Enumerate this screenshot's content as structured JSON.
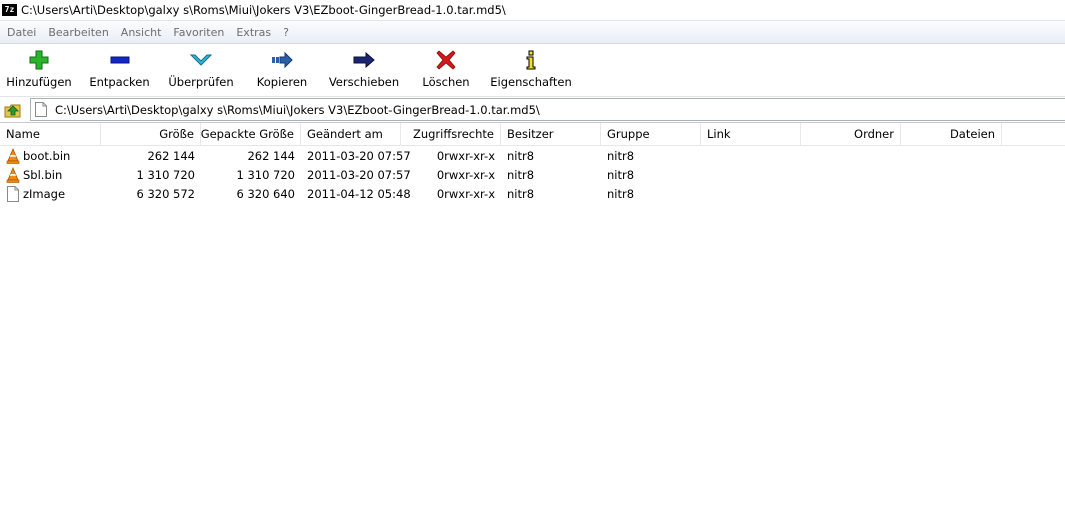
{
  "window": {
    "title": "C:\\Users\\Arti\\Desktop\\galxy s\\Roms\\Miui\\Jokers V3\\EZboot-GingerBread-1.0.tar.md5\\",
    "app_icon_text": "7z"
  },
  "menu": [
    {
      "label": "Datei"
    },
    {
      "label": "Bearbeiten"
    },
    {
      "label": "Ansicht"
    },
    {
      "label": "Favoriten"
    },
    {
      "label": "Extras"
    },
    {
      "label": "?"
    }
  ],
  "toolbar": [
    {
      "label": "Hinzufügen",
      "icon": "add-icon"
    },
    {
      "label": "Entpacken",
      "icon": "extract-icon"
    },
    {
      "label": "Überprüfen",
      "icon": "test-icon"
    },
    {
      "label": "Kopieren",
      "icon": "copy-icon"
    },
    {
      "label": "Verschieben",
      "icon": "move-icon"
    },
    {
      "label": "Löschen",
      "icon": "delete-icon"
    },
    {
      "label": "Eigenschaften",
      "icon": "info-icon"
    }
  ],
  "address": {
    "path": "C:\\Users\\Arti\\Desktop\\galxy s\\Roms\\Miui\\Jokers V3\\EZboot-GingerBread-1.0.tar.md5\\"
  },
  "columns": {
    "name": "Name",
    "size": "Größe",
    "packed": "Gepackte Größe",
    "modified": "Geändert am",
    "access": "Zugriffsrechte",
    "owner": "Besitzer",
    "group": "Gruppe",
    "link": "Link",
    "folders": "Ordner",
    "files": "Dateien"
  },
  "files": [
    {
      "name": "boot.bin",
      "size": "262 144",
      "packed": "262 144",
      "modified": "2011-03-20 07:57",
      "access": "0rwxr-xr-x",
      "owner": "nitr8",
      "group": "nitr8",
      "icon": "vlc-cone-icon"
    },
    {
      "name": "Sbl.bin",
      "size": "1 310 720",
      "packed": "1 310 720",
      "modified": "2011-03-20 07:57",
      "access": "0rwxr-xr-x",
      "owner": "nitr8",
      "group": "nitr8",
      "icon": "vlc-cone-icon"
    },
    {
      "name": "zImage",
      "size": "6 320 572",
      "packed": "6 320 640",
      "modified": "2011-04-12 05:48",
      "access": "0rwxr-xr-x",
      "owner": "nitr8",
      "group": "nitr8",
      "icon": "document-icon"
    }
  ],
  "colors": {
    "add_green": "#2bb32b",
    "extract_blue": "#1326c8",
    "test_cyan": "#2fb7d8",
    "copy_blue": "#2b5fa8",
    "move_navy": "#1a2470",
    "delete_red": "#d81818",
    "info_yellow": "#f4e21a",
    "vlc_orange": "#f08a12"
  }
}
